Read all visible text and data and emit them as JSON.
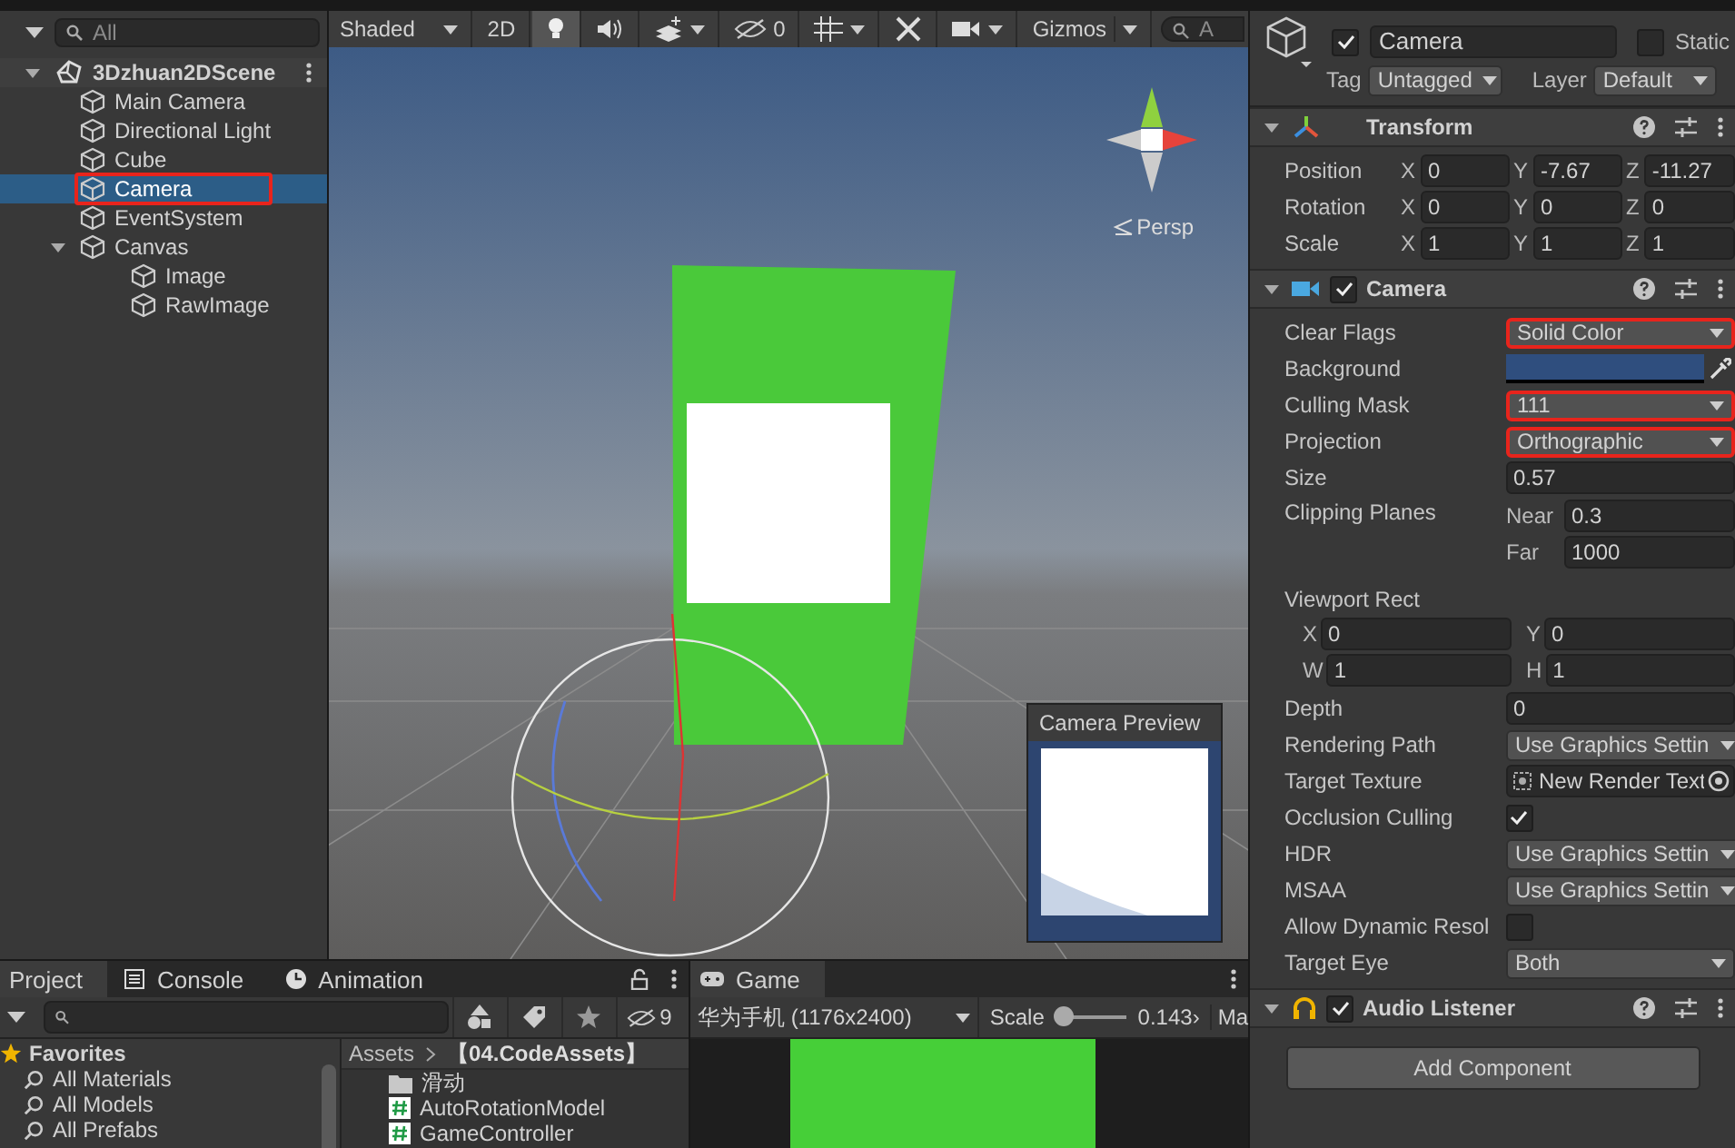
{
  "hierarchy": {
    "search": {
      "placeholder": "All"
    },
    "items": [
      {
        "kind": "scene",
        "name": "3Dzhuan2DScene",
        "expanded": true,
        "selected": false,
        "highlighted": false,
        "children": [
          {
            "kind": "object",
            "name": "Main Camera",
            "selected": false,
            "highlighted": false
          },
          {
            "kind": "object",
            "name": "Directional Light",
            "selected": false,
            "highlighted": false
          },
          {
            "kind": "object",
            "name": "Cube",
            "selected": false,
            "highlighted": false
          },
          {
            "kind": "object",
            "name": "Camera",
            "selected": true,
            "highlighted": true
          },
          {
            "kind": "object",
            "name": "EventSystem",
            "selected": false,
            "highlighted": false
          },
          {
            "kind": "object",
            "name": "Canvas",
            "expanded": true,
            "selected": false,
            "highlighted": false,
            "children": [
              {
                "kind": "object",
                "name": "Image",
                "selected": false,
                "highlighted": false
              },
              {
                "kind": "object",
                "name": "RawImage",
                "selected": false,
                "highlighted": false
              }
            ]
          }
        ]
      }
    ]
  },
  "scene": {
    "shading": "Shaded",
    "mode_2d": "2D",
    "lighting_on": true,
    "audio_on": false,
    "hidden_count": "0",
    "gizmos": "Gizmos",
    "search": {
      "placeholder": "A"
    },
    "view_label": "Persp",
    "preview": {
      "title": "Camera Preview"
    }
  },
  "inspector": {
    "header": {
      "enabled": true,
      "name": "Camera",
      "static": false,
      "static_label": "Static",
      "tag_label": "Tag",
      "tag": "Untagged",
      "layer_label": "Layer",
      "layer": "Default"
    },
    "components": [
      {
        "kind": "transform",
        "title": "Transform",
        "expanded": true,
        "rows": [
          {
            "kind": "vec3",
            "label": "Position",
            "fields": [
              {
                "axis": "X",
                "value": "0"
              },
              {
                "axis": "Y",
                "value": "-7.67"
              },
              {
                "axis": "Z",
                "value": "-11.27"
              }
            ]
          },
          {
            "kind": "vec3",
            "label": "Rotation",
            "fields": [
              {
                "axis": "X",
                "value": "0"
              },
              {
                "axis": "Y",
                "value": "0"
              },
              {
                "axis": "Z",
                "value": "0"
              }
            ]
          },
          {
            "kind": "vec3",
            "label": "Scale",
            "fields": [
              {
                "axis": "X",
                "value": "1"
              },
              {
                "axis": "Y",
                "value": "1"
              },
              {
                "axis": "Z",
                "value": "1"
              }
            ]
          }
        ]
      },
      {
        "kind": "camera",
        "title": "Camera",
        "enabled": true,
        "expanded": true,
        "rows": [
          {
            "kind": "dropdown",
            "label": "Clear Flags",
            "value": "Solid Color",
            "highlighted": true
          },
          {
            "kind": "color",
            "label": "Background",
            "color": "#2f4e7e"
          },
          {
            "kind": "dropdown",
            "label": "Culling Mask",
            "value": "111",
            "highlighted": true
          },
          {
            "kind": "dropdown",
            "label": "Projection",
            "value": "Orthographic",
            "highlighted": true
          },
          {
            "kind": "number",
            "label": "Size",
            "value": "0.57"
          },
          {
            "kind": "pair",
            "label": "Clipping Planes",
            "fields": [
              {
                "axis": "Near",
                "value": "0.3"
              },
              {
                "axis": "Far",
                "value": "1000"
              }
            ]
          },
          {
            "kind": "rect",
            "label": "Viewport Rect",
            "fields": [
              {
                "axis": "X",
                "value": "0"
              },
              {
                "axis": "Y",
                "value": "0"
              },
              {
                "axis": "W",
                "value": "1"
              },
              {
                "axis": "H",
                "value": "1"
              }
            ]
          },
          {
            "kind": "number",
            "label": "Depth",
            "value": "0"
          },
          {
            "kind": "dropdown",
            "label": "Rendering Path",
            "value": "Use Graphics Settin",
            "highlighted": false
          },
          {
            "kind": "object",
            "label": "Target Texture",
            "value": "New Render Text"
          },
          {
            "kind": "check",
            "label": "Occlusion Culling",
            "checked": true
          },
          {
            "kind": "dropdown",
            "label": "HDR",
            "value": "Use Graphics Settin",
            "highlighted": false
          },
          {
            "kind": "dropdown",
            "label": "MSAA",
            "value": "Use Graphics Settin",
            "highlighted": false
          },
          {
            "kind": "check",
            "label": "Allow Dynamic Resol",
            "checked": false
          },
          {
            "kind": "dropdown",
            "label": "Target Eye",
            "value": "Both",
            "highlighted": false
          }
        ]
      },
      {
        "kind": "audio",
        "title": "Audio Listener",
        "enabled": true,
        "expanded": true
      }
    ],
    "add_component": "Add Component"
  },
  "project": {
    "tabs": [
      {
        "kind": "project",
        "label": "Project",
        "selected": true
      },
      {
        "kind": "console",
        "label": "Console",
        "selected": false
      },
      {
        "kind": "animation",
        "label": "Animation",
        "selected": false
      }
    ],
    "hidden_count": "9",
    "favorites": {
      "title": "Favorites",
      "items": [
        "All Materials",
        "All Models",
        "All Prefabs"
      ]
    },
    "breadcrumb": [
      "Assets",
      "【04.CodeAssets】"
    ],
    "assets": [
      {
        "kind": "folder",
        "name": "滑动"
      },
      {
        "kind": "script",
        "name": "AutoRotationModel"
      },
      {
        "kind": "script",
        "name": "GameController"
      }
    ]
  },
  "game": {
    "tab": "Game",
    "display": "华为手机 (1176x2400)",
    "scale_label": "Scale",
    "scale": {
      "level": 0.1
    },
    "scale_value": "0.143›",
    "next_label": "Ma"
  }
}
